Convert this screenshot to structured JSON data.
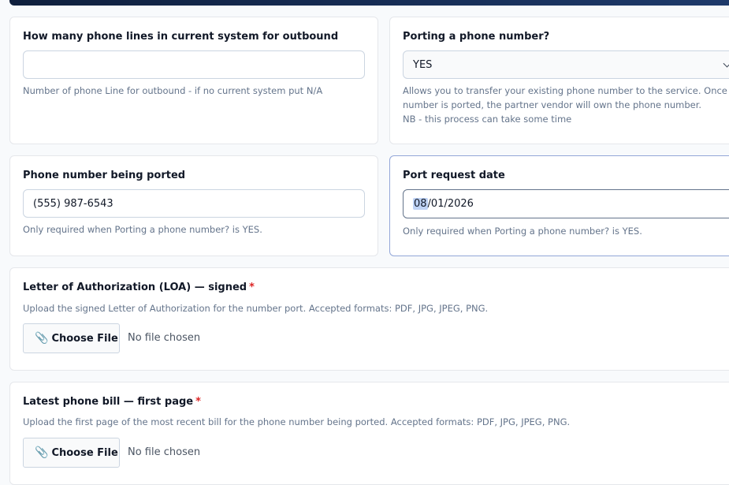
{
  "outbound_lines": {
    "label": "How many phone lines in current system for outbound",
    "value": "",
    "help": "Number of phone Line for outbound - if no current system put N/A"
  },
  "porting": {
    "label": "Porting a phone number?",
    "selected": "YES",
    "help_lines": [
      "Allows you to transfer your existing phone number to the service. Once the",
      "number is ported, the partner vendor will own the phone number.",
      "NB - this process can take some time"
    ]
  },
  "phone_ported": {
    "label": "Phone number being ported",
    "value": "(555) 987-6543",
    "help": "Only required when Porting a phone number? is YES."
  },
  "port_date": {
    "label": "Port request date",
    "month": "08",
    "rest": "/01/2026",
    "help": "Only required when Porting a phone number? is YES."
  },
  "loa": {
    "label": "Letter of Authorization (LOA) — signed",
    "required_mark": "*",
    "help": "Upload the signed Letter of Authorization for the number port. Accepted formats: PDF, JPG, JPEG, PNG.",
    "button_label": "Choose File",
    "status": "No file chosen"
  },
  "phone_bill": {
    "label": "Latest phone bill — first page",
    "required_mark": "*",
    "help": "Upload the first page of the most recent bill for the phone number being ported. Accepted formats: PDF, JPG, JPEG, PNG.",
    "button_label": "Choose File",
    "status": "No file chosen"
  },
  "icons": {
    "clip": "📎"
  }
}
